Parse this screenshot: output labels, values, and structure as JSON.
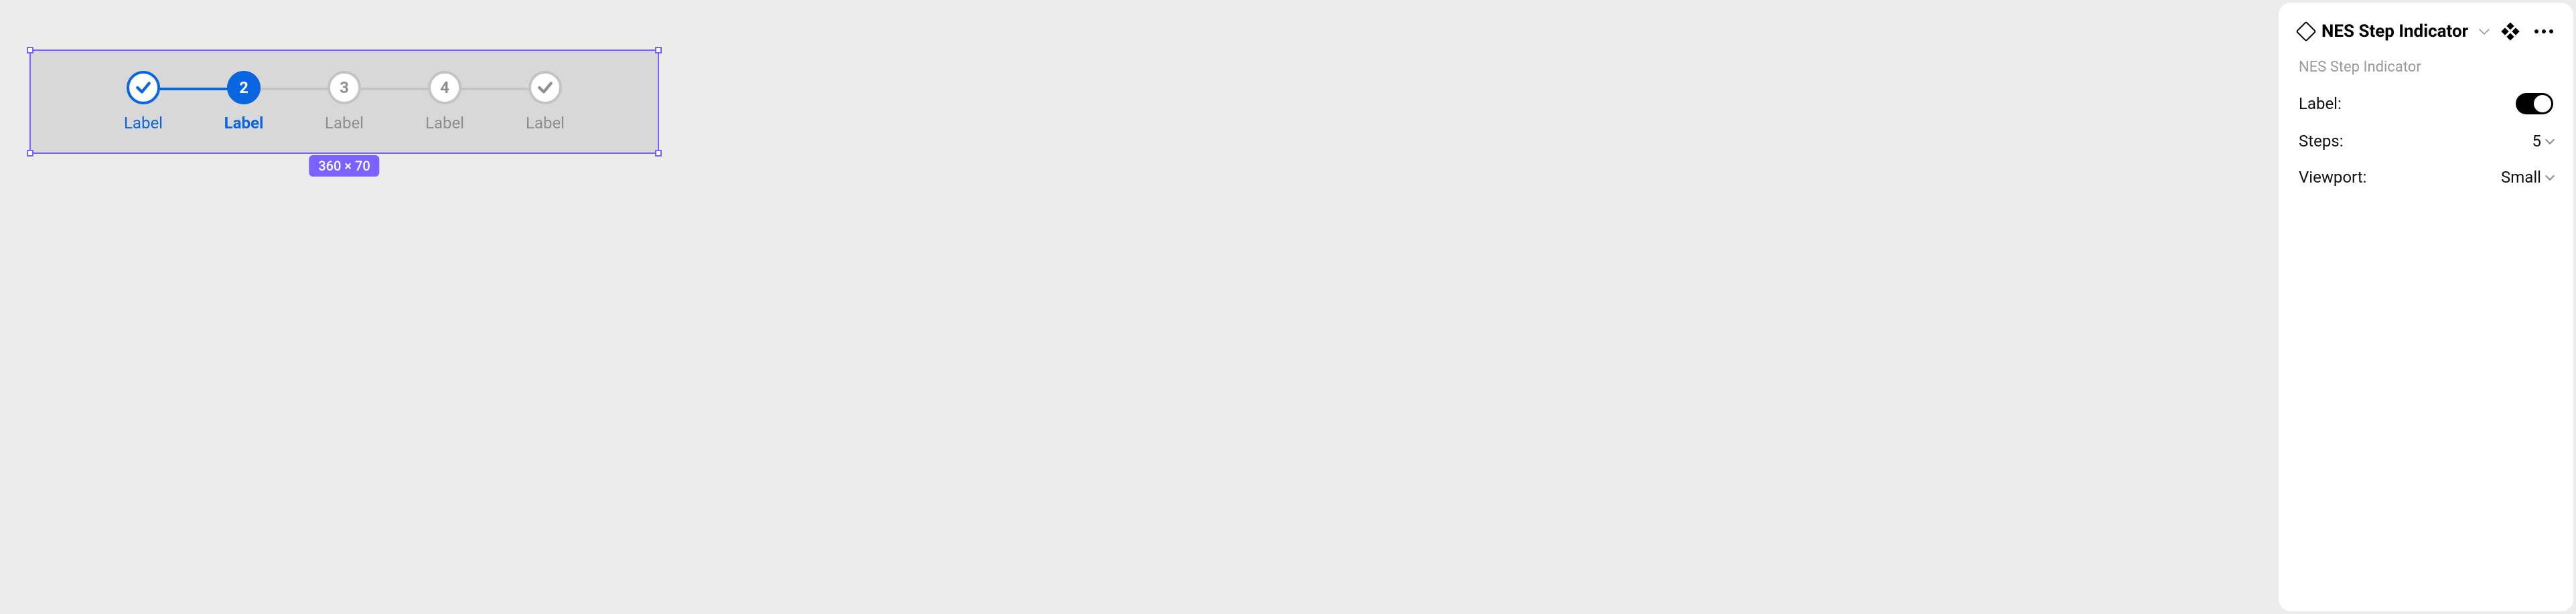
{
  "canvas": {
    "dimensions_badge": "360 × 70"
  },
  "stepper": {
    "steps": [
      {
        "state": "done",
        "marker_type": "check",
        "marker": "",
        "label": "Label"
      },
      {
        "state": "current",
        "marker_type": "text",
        "marker": "2",
        "label": "Label"
      },
      {
        "state": "upcoming",
        "marker_type": "text",
        "marker": "3",
        "label": "Label"
      },
      {
        "state": "upcoming",
        "marker_type": "text",
        "marker": "4",
        "label": "Label"
      },
      {
        "state": "upcoming",
        "marker_type": "check",
        "marker": "",
        "label": "Label"
      }
    ]
  },
  "panel": {
    "title": "NES Step Indicator",
    "subtitle": "NES Step Indicator",
    "props": {
      "label": {
        "name": "Label:",
        "value_type": "toggle",
        "value": true
      },
      "steps": {
        "name": "Steps:",
        "value_type": "select",
        "value": "5"
      },
      "viewport": {
        "name": "Viewport:",
        "value_type": "select",
        "value": "Small"
      }
    }
  }
}
